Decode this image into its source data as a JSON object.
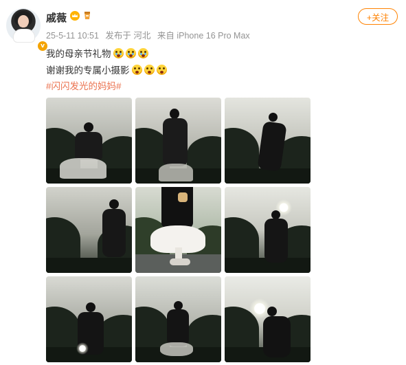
{
  "post": {
    "username": "戚薇",
    "date": "25-5-11 10:51",
    "location": "发布于 河北",
    "source": "来自 iPhone 16 Pro Max",
    "follow_label": "+关注",
    "text_line1": "我的母亲节礼物",
    "text_line2": "谢谢我的专属小摄影",
    "hashtag": "#闪闪发光的妈妈#"
  },
  "icons": {
    "verify": "verified-badge-icon",
    "crown": "crown-badge-icon",
    "cup": "cup-badge-icon",
    "emoji_line1": "crying-emoji-icon",
    "emoji_line2": "surprised-emoji-icon"
  },
  "colors": {
    "accent": "#ff8200",
    "hashtag": "#eb7350",
    "meta": "#939393"
  },
  "photos": [
    {
      "name": "photo-1"
    },
    {
      "name": "photo-2"
    },
    {
      "name": "photo-3"
    },
    {
      "name": "photo-4"
    },
    {
      "name": "photo-5"
    },
    {
      "name": "photo-6"
    },
    {
      "name": "photo-7"
    },
    {
      "name": "photo-8"
    },
    {
      "name": "photo-9"
    }
  ]
}
